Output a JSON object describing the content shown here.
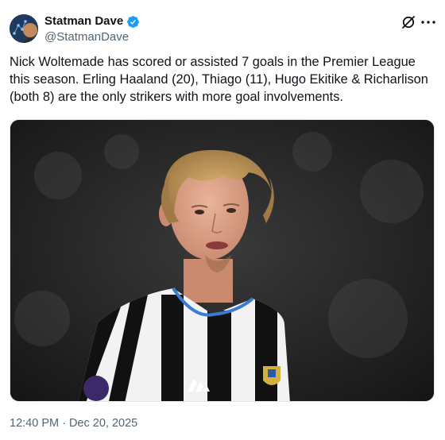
{
  "author": {
    "display_name": "Statman Dave",
    "handle": "@StatmanDave",
    "verified": true,
    "avatar_icon": "avatar-chart-icon",
    "verified_color": "#1d9bf0"
  },
  "header_actions": {
    "grok_icon": "grok-icon",
    "more_icon": "more-options-icon"
  },
  "tweet": {
    "text": "Nick Woltemade has scored or assisted 7 goals in the Premier League this season. Erling Haaland (20), Thiago (11), Hugo Ekitike & Richarlison (both 8) are the only strikers with more goal involvements.",
    "timestamp": "12:40 PM · Dec 20, 2025"
  },
  "media": {
    "kit_colors": {
      "stripe_black": "#111111",
      "stripe_white": "#f2f2f2",
      "collar": "#3a7bd5"
    }
  }
}
